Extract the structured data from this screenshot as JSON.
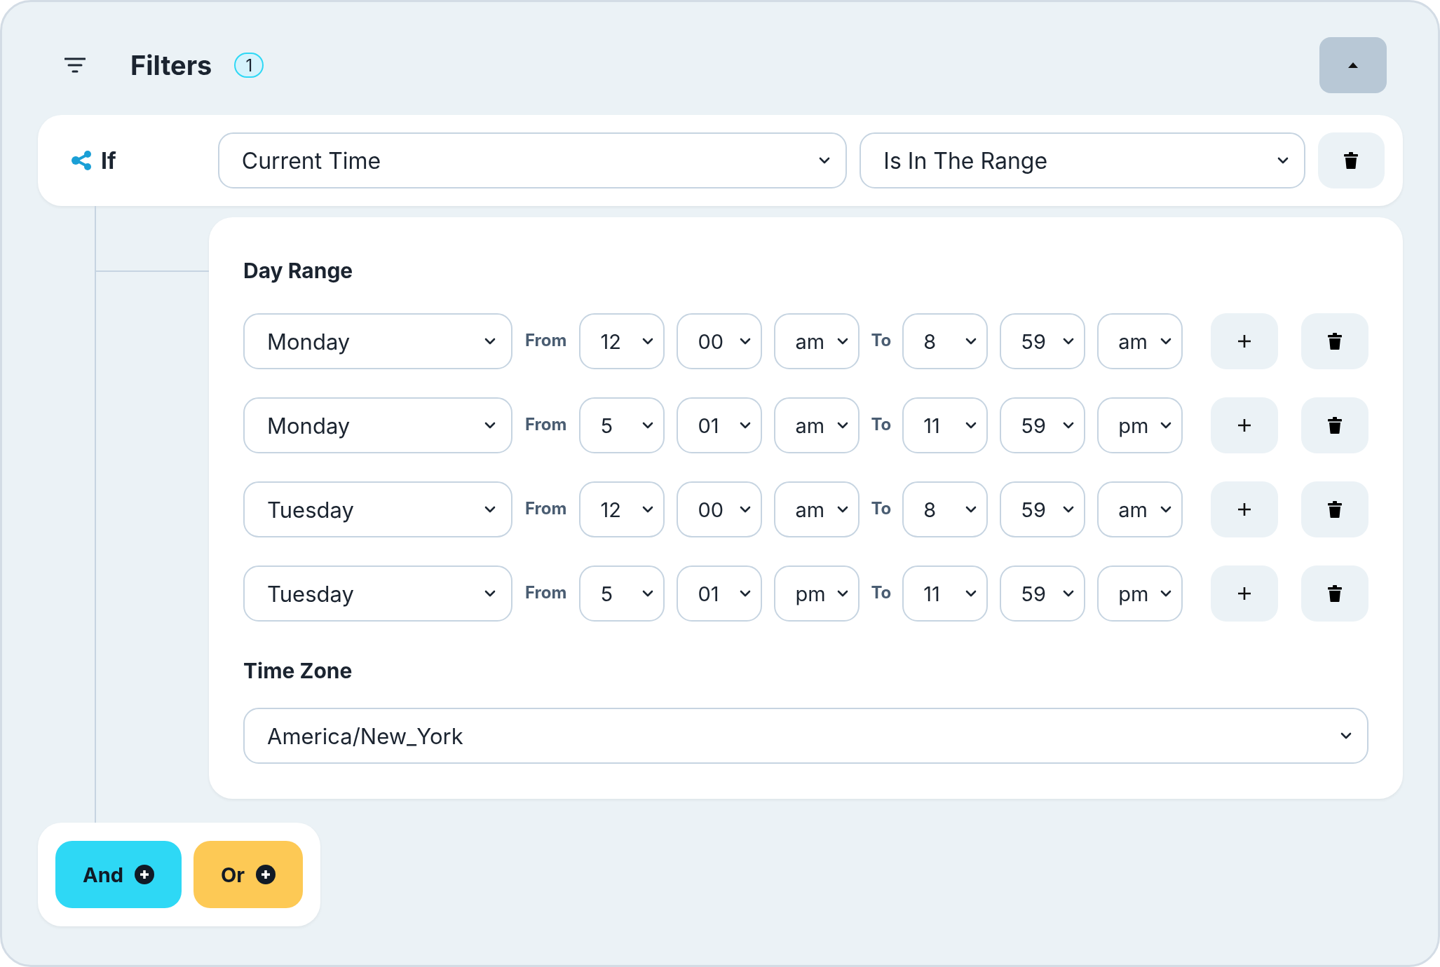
{
  "header": {
    "title": "Filters",
    "badge": "1"
  },
  "condition": {
    "label": "If",
    "field": "Current Time",
    "operator": "Is In The Range"
  },
  "day_range": {
    "title": "Day Range",
    "rows": [
      {
        "day": "Monday",
        "from_label": "From",
        "from_hour": "12",
        "from_minute": "00",
        "from_period": "am",
        "to_label": "To",
        "to_hour": "8",
        "to_minute": "59",
        "to_period": "am"
      },
      {
        "day": "Monday",
        "from_label": "From",
        "from_hour": "5",
        "from_minute": "01",
        "from_period": "am",
        "to_label": "To",
        "to_hour": "11",
        "to_minute": "59",
        "to_period": "pm"
      },
      {
        "day": "Tuesday",
        "from_label": "From",
        "from_hour": "12",
        "from_minute": "00",
        "from_period": "am",
        "to_label": "To",
        "to_hour": "8",
        "to_minute": "59",
        "to_period": "am"
      },
      {
        "day": "Tuesday",
        "from_label": "From",
        "from_hour": "5",
        "from_minute": "01",
        "from_period": "pm",
        "to_label": "To",
        "to_hour": "11",
        "to_minute": "59",
        "to_period": "pm"
      }
    ]
  },
  "time_zone": {
    "title": "Time Zone",
    "value": "America/New_York"
  },
  "connectors": [
    {
      "label": "And",
      "color": "#2ed8f5"
    },
    {
      "label": "Or",
      "color": "#fdc955"
    }
  ]
}
